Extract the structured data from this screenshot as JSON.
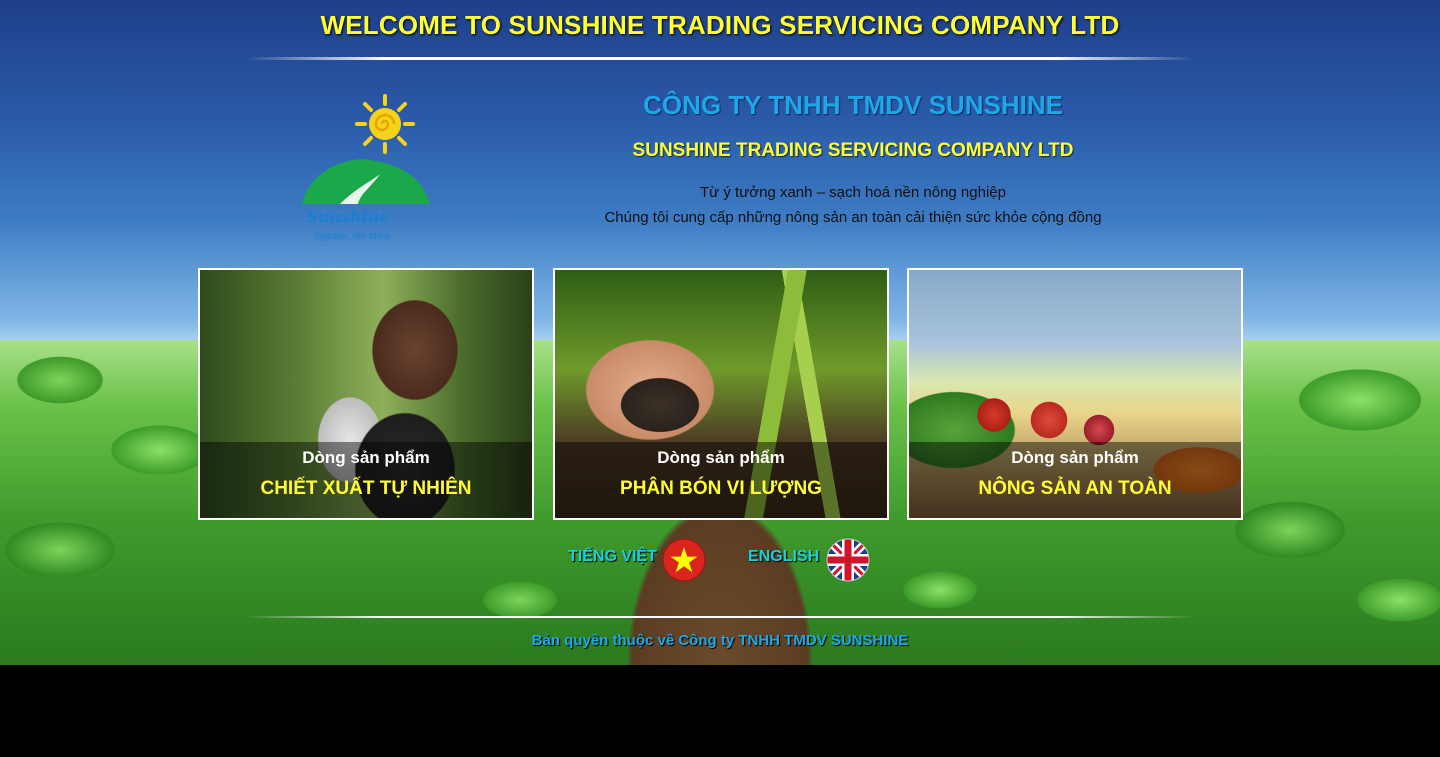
{
  "header": {
    "welcome": "WELCOME TO SUNSHINE TRADING SERVICING COMPANY LTD"
  },
  "logo": {
    "brand": "Sunshine",
    "tagline": "Together, We Shine"
  },
  "company": {
    "name_vn": "CÔNG TY TNHH TMDV SUNSHINE",
    "name_en": "SUNSHINE TRADING SERVICING COMPANY LTD",
    "slogan_line1": "Từ ý tưởng xanh – sạch hoá nền nông nghiệp",
    "slogan_line2": "Chúng tôi cung cấp những nông sản an toàn cải thiện sức khỏe cộng đồng"
  },
  "products": [
    {
      "subtitle": "Dòng sản phẩm",
      "title": "CHIẾT XUẤT TỰ NHIÊN"
    },
    {
      "subtitle": "Dòng sản phẩm",
      "title": "PHÂN BÓN VI LƯỢNG"
    },
    {
      "subtitle": "Dòng sản phẩm",
      "title": "NÔNG SẢN AN TOÀN"
    }
  ],
  "languages": {
    "vietnamese": "TIẾNG VIỆT",
    "english": "ENGLISH"
  },
  "footer": {
    "copyright": "Bản quyền thuộc về Công ty TNHH TMDV SUNSHINE"
  },
  "colors": {
    "title_yellow": "#ffff33",
    "accent_blue": "#1ea7e8",
    "language_cyan": "#1ad0d8",
    "logo_green": "#1aa84a",
    "sun_yellow": "#f7d21a"
  }
}
